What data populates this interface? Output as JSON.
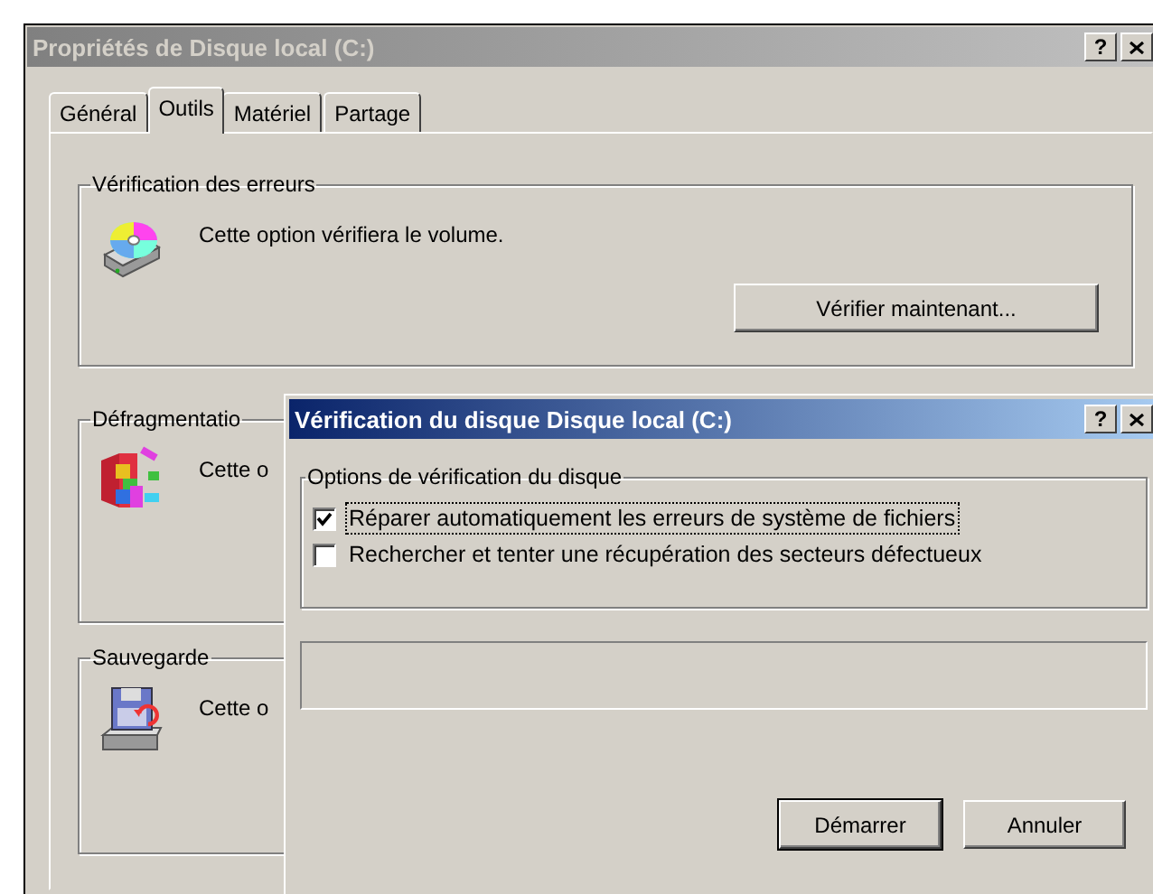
{
  "window": {
    "title": "Propriétés de Disque local (C:)",
    "active": false,
    "help_button": "?"
  },
  "tabs": [
    {
      "label": "Général",
      "selected": false
    },
    {
      "label": "Outils",
      "selected": true
    },
    {
      "label": "Matériel",
      "selected": false
    },
    {
      "label": "Partage",
      "selected": false
    }
  ],
  "groups": [
    {
      "title": "Vérification des erreurs",
      "text": "Cette option vérifiera le volume.",
      "button": "Vérifier maintenant..."
    },
    {
      "title": "Défragmentatio",
      "text": "Cette o"
    },
    {
      "title": "Sauvegarde",
      "text": "Cette o"
    }
  ],
  "dialog": {
    "title": "Vérification du disque Disque local (C:)",
    "active": true,
    "help_button": "?",
    "options_group": {
      "title": "Options de vérification du disque",
      "options": [
        {
          "label": "Réparer automatiquement les erreurs de système de fichiers",
          "checked": true,
          "focused": true
        },
        {
          "label": "Rechercher et tenter une récupération des secteurs défectueux",
          "checked": false,
          "focused": false
        }
      ]
    },
    "buttons": [
      {
        "label": "Démarrer",
        "default": true
      },
      {
        "label": "Annuler",
        "default": false
      }
    ]
  }
}
